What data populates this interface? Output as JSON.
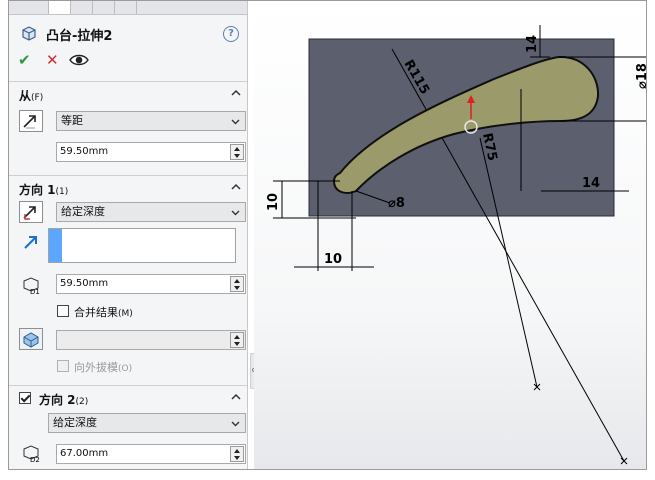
{
  "feature": {
    "title": "凸台-拉伸2",
    "help_glyph": "?"
  },
  "actions": {
    "ok_glyph": "✔",
    "cancel_glyph": "✕"
  },
  "from_section": {
    "title": "从",
    "shortcut": "(F)",
    "condition": "等距",
    "offset_value": "59.50mm"
  },
  "direction1": {
    "title": "方向 1",
    "shortcut": "(1)",
    "end_condition": "给定深度",
    "depth_label": "D1",
    "depth_value": "59.50mm",
    "merge_label": "合并结果",
    "merge_shortcut": "(M)",
    "merge_checked": false,
    "draft_label": "向外拔模",
    "draft_shortcut": "(O)"
  },
  "direction2": {
    "title": "方向 2",
    "shortcut": "(2)",
    "enabled": true,
    "end_condition": "给定深度",
    "depth_label": "D2",
    "depth_value": "67.00mm"
  },
  "sketch": {
    "dimensions": {
      "top_vertical": "14",
      "radius_large": "R115",
      "radius_small": "R75",
      "diameter_end": "⌀18",
      "diameter_small": "⌀8",
      "left_vertical": "10",
      "bottom_horizontal": "10",
      "right_horizontal": "14"
    }
  },
  "colors": {
    "sketch_plane": "#5b5f6e",
    "profile_fill": "#9a9a6a",
    "listbox_selection": "#5da6ff",
    "ok": "#2e9a37",
    "cancel": "#d12f2f"
  }
}
